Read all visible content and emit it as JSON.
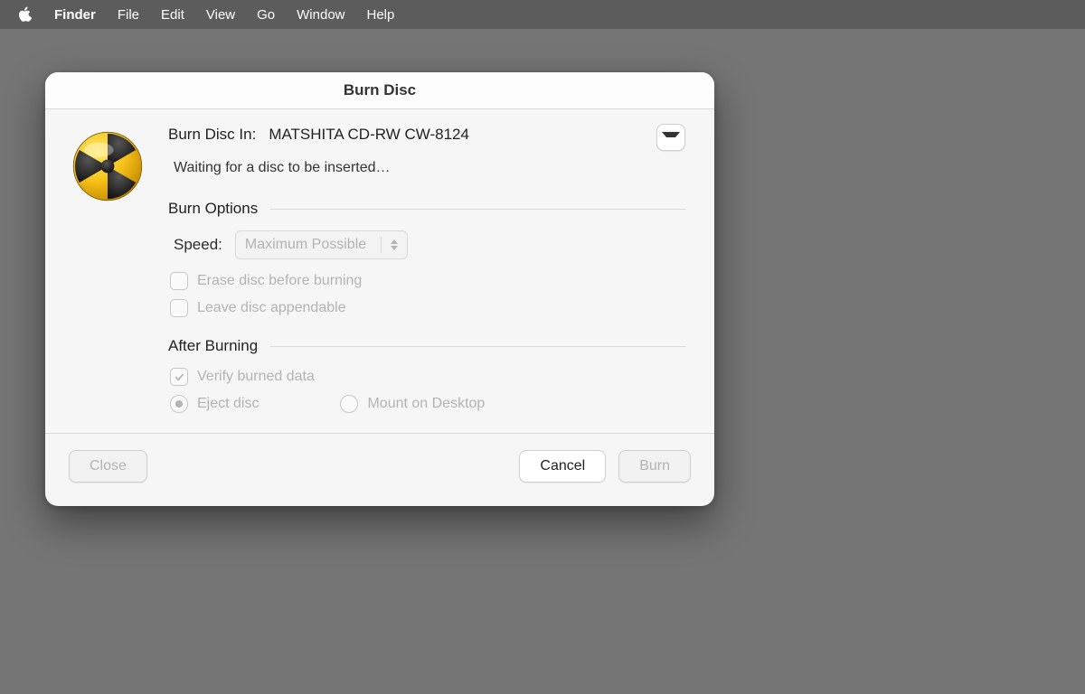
{
  "menubar": {
    "app": "Finder",
    "items": [
      "File",
      "Edit",
      "View",
      "Go",
      "Window",
      "Help"
    ]
  },
  "dialog": {
    "title": "Burn Disc",
    "drive_label": "Burn Disc In:",
    "drive_value": "MATSHITA CD-RW CW-8124",
    "status": "Waiting for a disc to be inserted…",
    "burn_options": {
      "heading": "Burn Options",
      "speed_label": "Speed:",
      "speed_value": "Maximum Possible",
      "erase_label": "Erase disc before burning",
      "appendable_label": "Leave disc appendable",
      "erase_checked": false,
      "appendable_checked": false
    },
    "after": {
      "heading": "After Burning",
      "verify_label": "Verify burned data",
      "verify_checked": true,
      "eject_label": "Eject disc",
      "mount_label": "Mount on Desktop",
      "selected": "eject"
    },
    "buttons": {
      "close": "Close",
      "cancel": "Cancel",
      "burn": "Burn"
    }
  }
}
